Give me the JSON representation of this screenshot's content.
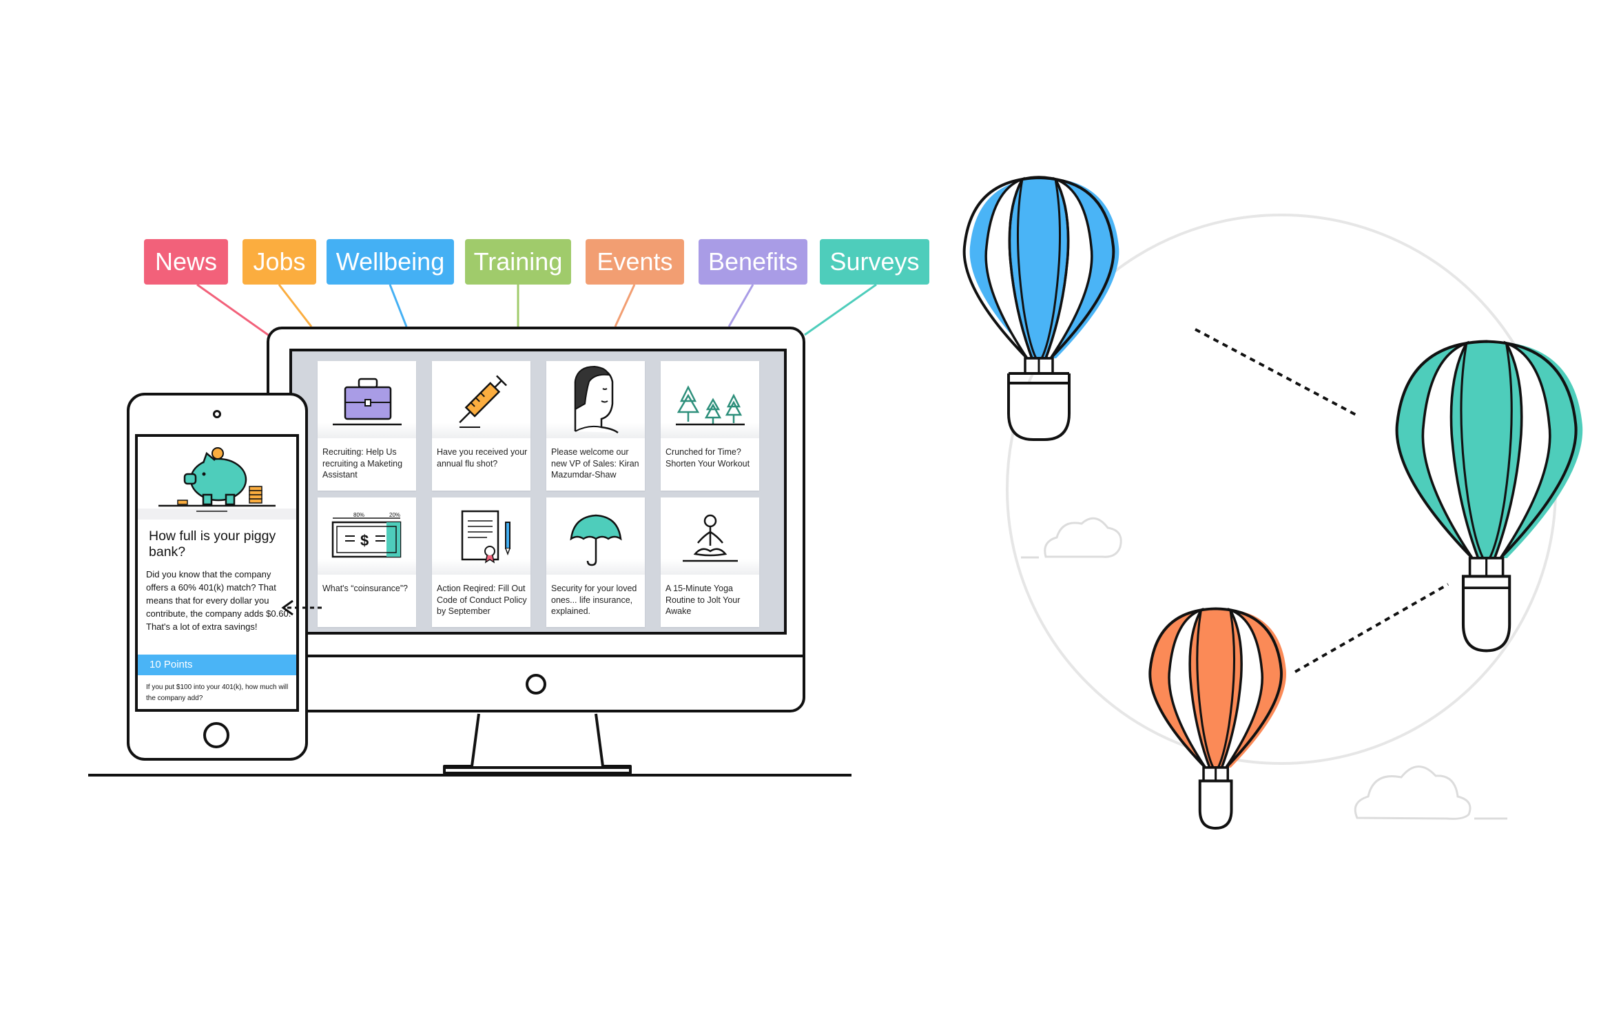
{
  "tags": [
    {
      "label": "News",
      "color": "#f2617a"
    },
    {
      "label": "Jobs",
      "color": "#fbad3f"
    },
    {
      "label": "Wellbeing",
      "color": "#44b0f4"
    },
    {
      "label": "Training",
      "color": "#a0cb6b"
    },
    {
      "label": "Events",
      "color": "#f29e72"
    },
    {
      "label": "Benefits",
      "color": "#a99ce6"
    },
    {
      "label": "Surveys",
      "color": "#4ecdbb"
    }
  ],
  "cards": [
    {
      "text": "Recruiting: Help Us recruiting a Maketing Assistant",
      "icon": "briefcase-icon"
    },
    {
      "text": "Have you received your annual flu shot?",
      "icon": "syringe-icon"
    },
    {
      "text": "Please welcome our new VP of Sales: Kiran Mazumdar-Shaw",
      "icon": "person-portrait-icon"
    },
    {
      "text": "Crunched for Time? Shorten Your Workout",
      "icon": "trees-icon"
    },
    {
      "text": "What's “coinsurance”?",
      "icon": "dollar-bill-icon",
      "bar_labels": [
        "80%",
        "20%"
      ]
    },
    {
      "text": "Action Reqired: Fill Out Code of Conduct Policy by September",
      "icon": "certificate-document-icon"
    },
    {
      "text": "Security for your loved ones... life insurance, explained.",
      "icon": "umbrella-icon"
    },
    {
      "text": "A 15-Minute Yoga Routine to Jolt Your Awake",
      "icon": "meditation-icon"
    }
  ],
  "phone": {
    "title": "How full is your piggy bank?",
    "body": "Did you know that the company offers a 60% 401(k) match? That means that for every dollar you contribute, the company adds $0.60. That's a lot of extra savings!",
    "points": "10 Points",
    "question": "If you put $100 into your 401(k), how much will the company add?",
    "icon": "piggy-bank-icon"
  },
  "colors": {
    "blue": "#4ab4f6",
    "teal": "#4ecdbb",
    "orange": "#fb8a57",
    "outline": "#111111"
  }
}
